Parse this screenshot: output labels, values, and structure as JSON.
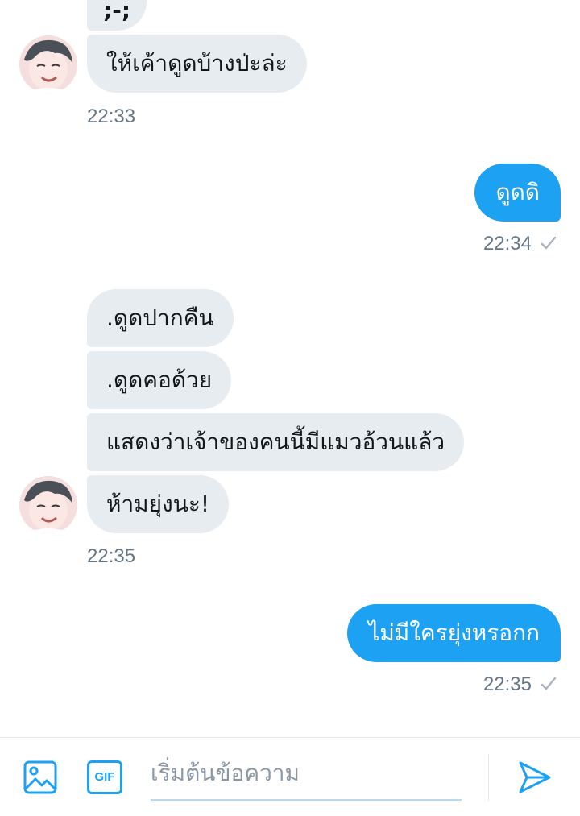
{
  "messages": [
    {
      "from": "them",
      "text": ";-;"
    },
    {
      "from": "them",
      "text": "ให้เค้าดูดบ้างป่ะล่ะ"
    },
    {
      "from": "them",
      "time": "22:33"
    },
    {
      "from": "me",
      "text": "ดูดดิ",
      "time": "22:34"
    },
    {
      "from": "them",
      "text": ".ดูดปากคืน"
    },
    {
      "from": "them",
      "text": ".ดูดคอด้วย"
    },
    {
      "from": "them",
      "text": "แสดงว่าเจ้าของคนนี้มีแมวอ้วนแล้ว"
    },
    {
      "from": "them",
      "text": "ห้ามยุ่งนะ!",
      "time": "22:35"
    },
    {
      "from": "me",
      "text": "ไม่มีใครยุ่งหรอกก",
      "time": "22:35"
    }
  ],
  "composer": {
    "placeholder": "เริ่มต้นข้อความ",
    "gif_label": "GIF",
    "icons": [
      "image-icon",
      "gif-icon",
      "send-icon"
    ]
  },
  "colors": {
    "outgoing_bubble": "#1da1f2",
    "incoming_bubble": "#e6ecf0",
    "timestamp": "#657786",
    "accent": "#1da1f2"
  }
}
